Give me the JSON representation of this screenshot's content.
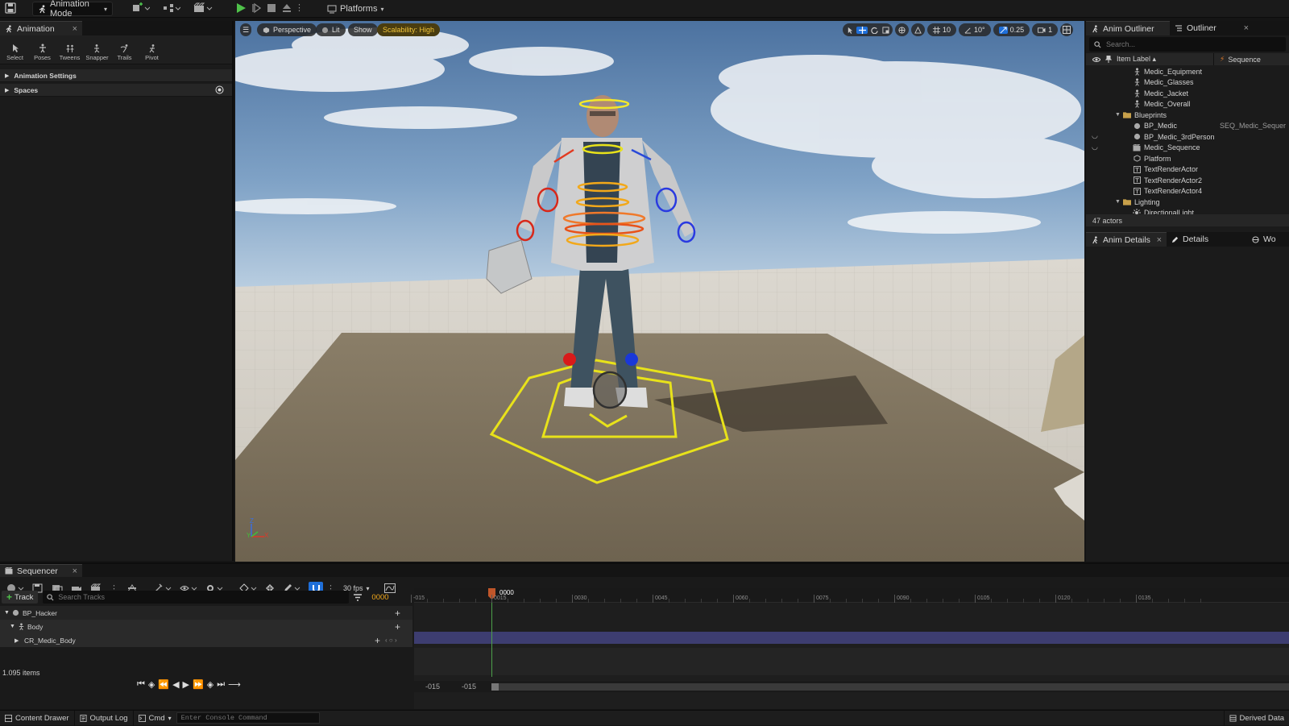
{
  "topbar": {
    "mode_label": "Animation Mode",
    "platforms_label": "Platforms"
  },
  "left_panel": {
    "tab_label": "Animation",
    "tools": [
      {
        "icon": "select-icon",
        "label": "Select"
      },
      {
        "icon": "poses-icon",
        "label": "Poses"
      },
      {
        "icon": "tweens-icon",
        "label": "Tweens"
      },
      {
        "icon": "snapper-icon",
        "label": "Snapper"
      },
      {
        "icon": "trails-icon",
        "label": "Trails"
      },
      {
        "icon": "pivot-icon",
        "label": "Pivot"
      }
    ],
    "sections": [
      "Animation Settings",
      "Spaces"
    ]
  },
  "viewport": {
    "perspective_label": "Perspective",
    "lit_label": "Lit",
    "show_label": "Show",
    "scalability_label": "Scalability: High",
    "grid_snap": "10",
    "rotation_snap": "10°",
    "scale_snap": "0.25",
    "camera_speed": "1",
    "axis_z": "Z",
    "axis_y": "Y",
    "axis_x": "X"
  },
  "right_panel": {
    "tabs": [
      "Anim Outliner",
      "Outliner"
    ],
    "search_placeholder": "Search...",
    "col_item_label": "Item Label",
    "col_sequence": "Sequence",
    "rows": [
      {
        "label": "Medic_Equipment",
        "indent": 2,
        "icon": "skeletal-mesh-icon",
        "eye": false,
        "seq": ""
      },
      {
        "label": "Medic_Glasses",
        "indent": 2,
        "icon": "skeletal-mesh-icon",
        "eye": false,
        "seq": ""
      },
      {
        "label": "Medic_Jacket",
        "indent": 2,
        "icon": "skeletal-mesh-icon",
        "eye": false,
        "seq": ""
      },
      {
        "label": "Medic_Overall",
        "indent": 2,
        "icon": "skeletal-mesh-icon",
        "eye": false,
        "seq": ""
      },
      {
        "label": "Blueprints",
        "indent": 1,
        "icon": "folder-icon",
        "eye": false,
        "seq": ""
      },
      {
        "label": "BP_Medic",
        "indent": 2,
        "icon": "actor-icon",
        "eye": false,
        "seq": "SEQ_Medic_Sequer"
      },
      {
        "label": "BP_Medic_3rdPerson",
        "indent": 2,
        "icon": "actor-icon",
        "eye": true,
        "seq": ""
      },
      {
        "label": "Medic_Sequence",
        "indent": 2,
        "icon": "sequence-icon",
        "eye": true,
        "seq": ""
      },
      {
        "label": "Platform",
        "indent": 2,
        "icon": "mesh-icon",
        "eye": false,
        "seq": ""
      },
      {
        "label": "TextRenderActor",
        "indent": 2,
        "icon": "text-render-icon",
        "eye": false,
        "seq": ""
      },
      {
        "label": "TextRenderActor2",
        "indent": 2,
        "icon": "text-render-icon",
        "eye": false,
        "seq": ""
      },
      {
        "label": "TextRenderActor4",
        "indent": 2,
        "icon": "text-render-icon",
        "eye": false,
        "seq": ""
      },
      {
        "label": "Lighting",
        "indent": 1,
        "icon": "folder-icon",
        "eye": false,
        "seq": ""
      },
      {
        "label": "DirectionalLight",
        "indent": 2,
        "icon": "light-icon",
        "eye": false,
        "seq": ""
      }
    ],
    "actor_count": "47 actors",
    "details_tabs": [
      "Anim Details",
      "Details",
      "Wo"
    ]
  },
  "sequencer": {
    "tab_label": "Sequencer",
    "fps_label": "30 fps",
    "add_track_label": "Track",
    "search_placeholder": "Search Tracks",
    "current_frame": "0000",
    "playhead_label": "0000",
    "tracks": [
      {
        "label": "BP_Hacker",
        "indent": 0
      },
      {
        "label": "Body",
        "indent": 1
      },
      {
        "label": "CR_Medic_Body",
        "indent": 2
      }
    ],
    "items_count": "1.095 items",
    "range_start": "-015",
    "range_start2": "-015",
    "ticks": [
      "-015",
      "0015",
      "0030",
      "0045",
      "0060",
      "0075",
      "0090",
      "0105",
      "0120",
      "0135"
    ]
  },
  "statusbar": {
    "content_drawer": "Content Drawer",
    "output_log": "Output Log",
    "cmd": "Cmd",
    "console_placeholder": "Enter Console Command",
    "derived_data": "Derived Data"
  }
}
